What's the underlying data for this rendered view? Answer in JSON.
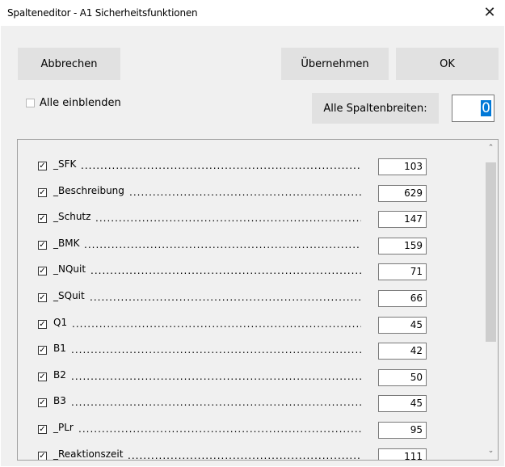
{
  "window": {
    "title": "Spalteneditor - A1 Sicherheitsfunktionen",
    "close_glyph": "✕"
  },
  "buttons": {
    "cancel": "Abbrechen",
    "apply": "Übernehmen",
    "ok": "OK"
  },
  "show_all": {
    "label": "Alle einblenden",
    "checked": false
  },
  "column_widths": {
    "label": "Alle Spaltenbreiten:",
    "value": "0"
  },
  "columns": [
    {
      "name": "_SFK",
      "width": "103",
      "checked": true
    },
    {
      "name": "_Beschreibung",
      "width": "629",
      "checked": true
    },
    {
      "name": "_Schutz",
      "width": "147",
      "checked": true
    },
    {
      "name": "_BMK",
      "width": "159",
      "checked": true
    },
    {
      "name": "_NQuit",
      "width": "71",
      "checked": true
    },
    {
      "name": "_SQuit",
      "width": "66",
      "checked": true
    },
    {
      "name": "Q1",
      "width": "45",
      "checked": true
    },
    {
      "name": "B1",
      "width": "42",
      "checked": true
    },
    {
      "name": "B2",
      "width": "50",
      "checked": true
    },
    {
      "name": "B3",
      "width": "45",
      "checked": true
    },
    {
      "name": "_PLr",
      "width": "95",
      "checked": true
    },
    {
      "name": "_Reaktionszeit",
      "width": "111",
      "checked": true
    }
  ],
  "scrollbar": {
    "up_icon": "chevron-up-icon",
    "down_icon": "chevron-down-icon"
  }
}
